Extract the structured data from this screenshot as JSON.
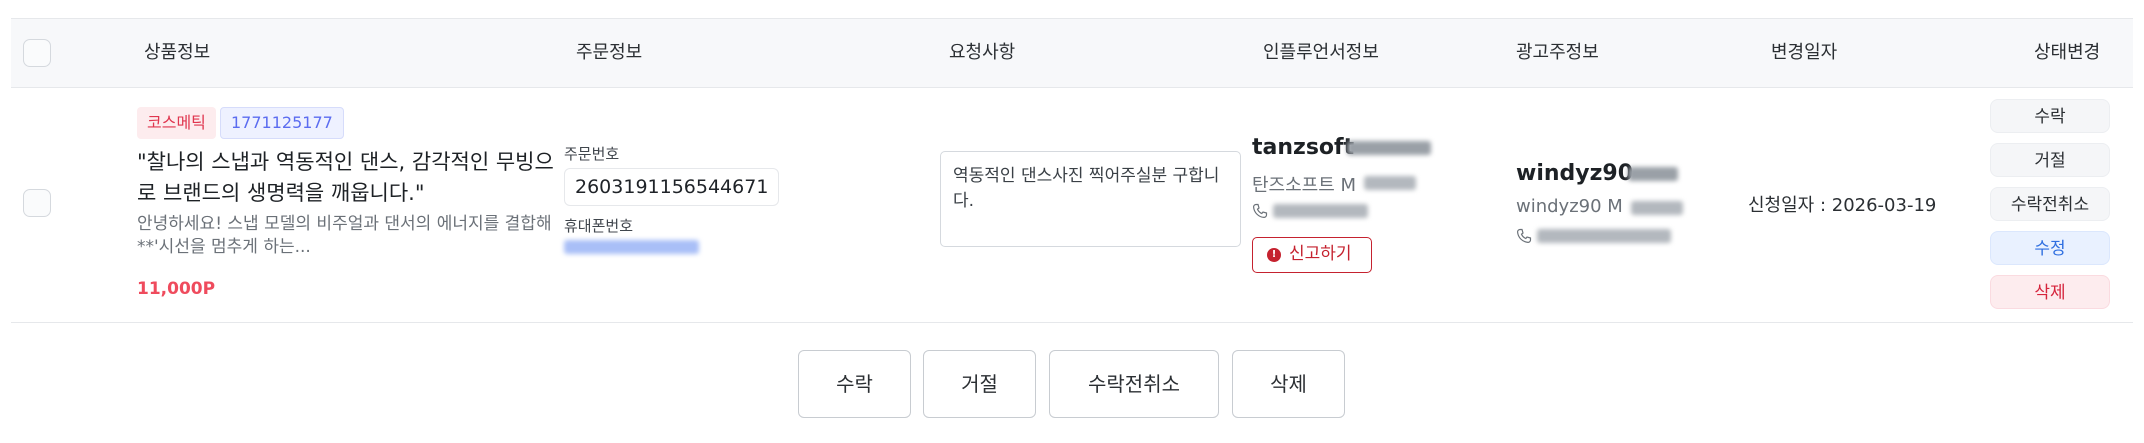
{
  "header": {
    "col_product": "상품정보",
    "col_order": "주문정보",
    "col_request": "요청사항",
    "col_influencer": "인플루언서정보",
    "col_advertiser": "광고주정보",
    "col_changed": "변경일자",
    "col_status": "상태변경"
  },
  "row": {
    "category": "코스메틱",
    "product_id": "1771125177",
    "title": "\"찰나의 스냅과 역동적인 댄스, 감각적인 무빙으로 브랜드의 생명력을 깨웁니다.\"",
    "description": "안녕하세요! 스냅 모델의 비주얼과 댄서의 에너지를 결합해 **'시선을 멈추게 하는...",
    "price": "11,000P",
    "order_label": "주문번호",
    "order_number": "2603191156544671",
    "phone_label": "휴대폰번호",
    "request": "역동적인 댄스사진 찍어주실분 구합니다.",
    "influencer_id": "tanzsoft",
    "influencer_name": "탄즈소프트 M",
    "report_label": "신고하기",
    "advertiser_id": "windyz90",
    "advertiser_name": "windyz90 M",
    "applied_date": "신청일자 : 2026-03-19",
    "status_buttons": {
      "accept": "수락",
      "reject": "거절",
      "cancel_accept": "수락전취소",
      "edit": "수정",
      "delete": "삭제"
    }
  },
  "actions": {
    "accept": "수락",
    "reject": "거절",
    "cancel_accept": "수락전취소",
    "delete": "삭제"
  },
  "colors": {
    "danger": "#c5222f",
    "accent_blue": "#2f6fe0",
    "price": "#ef4b5d"
  }
}
